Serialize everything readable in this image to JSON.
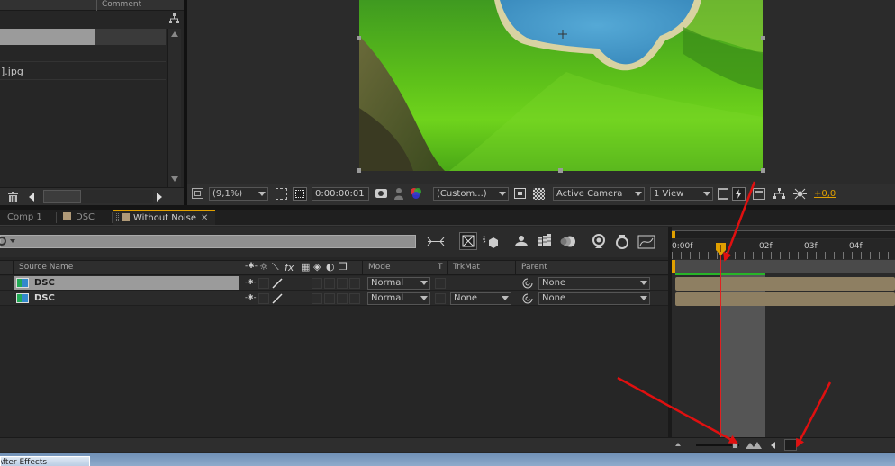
{
  "project": {
    "comment_header": "Comment",
    "file_item": "].jpg"
  },
  "viewer": {
    "zoom": "(9,1%)",
    "timecode": "0:00:00:01",
    "resolution": "(Custom...)",
    "camera": "Active Camera",
    "views": "1 View",
    "exposure": "+0,0"
  },
  "comp_tabs": [
    {
      "label": "Comp 1"
    },
    {
      "label": "DSC"
    },
    {
      "label": "Without Noise"
    }
  ],
  "timeline": {
    "columns": {
      "source_name": "Source Name",
      "switches": "fx",
      "mode": "Mode",
      "t": "T",
      "trkmat": "TrkMat",
      "parent": "Parent"
    },
    "layers": [
      {
        "name": "DSC",
        "mode": "Normal",
        "trkmat": "",
        "parent": "None"
      },
      {
        "name": "DSC",
        "mode": "Normal",
        "trkmat": "None",
        "parent": "None"
      }
    ],
    "ruler": [
      "0:00f",
      "02f",
      "03f",
      "04f"
    ]
  },
  "taskbar": {
    "app": "After Effects"
  },
  "colors": {
    "accent_orange": "#e0a000",
    "playhead_red": "#e02020",
    "arrow_red": "#e01010",
    "clip_tan": "#8e7f62",
    "work_area_green": "#28b428"
  }
}
